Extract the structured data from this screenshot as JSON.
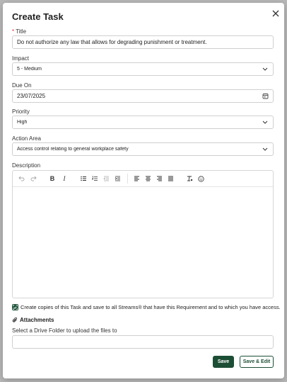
{
  "dialog": {
    "title": "Create Task",
    "close_icon": "close-icon"
  },
  "fields": {
    "title": {
      "required_mark": "*",
      "label": "Title",
      "value": "Do not authorize any law that allows for degrading punishment or treatment."
    },
    "impact": {
      "label": "Impact",
      "value": "5 - Medium"
    },
    "due_on": {
      "label": "Due On",
      "value": "23/07/2025"
    },
    "priority": {
      "label": "Priority",
      "value": "High"
    },
    "action_area": {
      "label": "Action Area",
      "value": "Access control relating to general workplace safety"
    },
    "description": {
      "label": "Description",
      "value": ""
    }
  },
  "editor_toolbar": [
    "undo-icon",
    "redo-icon",
    "bold-icon",
    "italic-icon",
    "bullet-list-icon",
    "numbered-list-icon",
    "outdent-icon",
    "indent-icon",
    "align-left-icon",
    "align-center-icon",
    "align-right-icon",
    "justify-icon",
    "clear-format-icon",
    "emoji-icon"
  ],
  "copies": {
    "checked": true,
    "text": "Create copies of this Task and save to all Streams® that have this Requirement and to which you have access."
  },
  "attachments": {
    "heading": "Attachments",
    "folder_label": "Select a Drive Folder to upload the files to",
    "folder_value": ""
  },
  "buttons": {
    "save": "Save",
    "save_edit": "Save & Edit"
  },
  "colors": {
    "primary": "#1c4e35",
    "required": "#dd3333",
    "border": "#cfcfcf"
  }
}
